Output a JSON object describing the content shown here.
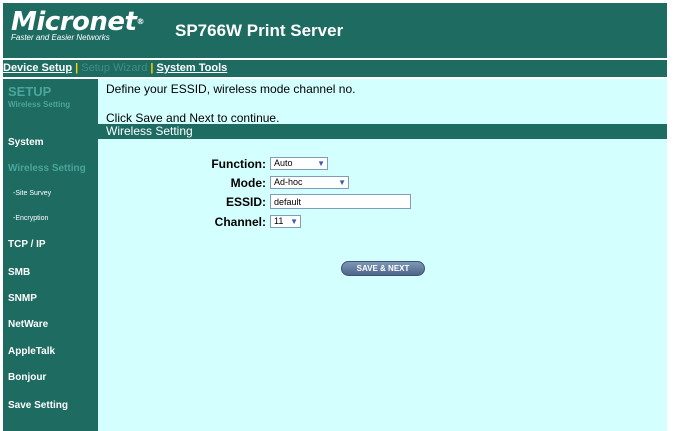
{
  "header": {
    "brand": "Micronet",
    "brand_tm": "®",
    "tagline": "Faster and Easier Networks",
    "product": "SP766W Print Server"
  },
  "topnav": {
    "device_setup": "Device Setup",
    "sep1": " | ",
    "setup_wizard": "Setup Wizard",
    "sep2": " | ",
    "system_tools": "System Tools"
  },
  "sidebar": {
    "section": "SETUP",
    "section_sub": "Wireless Setting",
    "items": {
      "system": "System",
      "wireless_setting": "Wireless Setting",
      "site_survey": "-Site Survey",
      "encryption": "-Encryption",
      "tcpip": "TCP / IP",
      "smb": "SMB",
      "snmp": "SNMP",
      "netware": "NetWare",
      "appletalk": "AppleTalk",
      "bonjour": "Bonjour",
      "save_setting": "Save Setting"
    }
  },
  "main": {
    "instruction1": "Define your ESSID, wireless mode channel no.",
    "instruction2": "Click Save and Next to continue.",
    "section_title": "Wireless Setting",
    "form": {
      "function_label": "Function:",
      "function_value": "Auto",
      "mode_label": "Mode:",
      "mode_value": "Ad-hoc",
      "essid_label": "ESSID:",
      "essid_value": "default",
      "channel_label": "Channel:",
      "channel_value": "11"
    },
    "save_next": "SAVE & NEXT"
  },
  "colors": {
    "brand_teal": "#1e6b62",
    "content_bg": "#d4ffff",
    "inactive_text": "#4aa59a",
    "separator": "#ffd200"
  }
}
